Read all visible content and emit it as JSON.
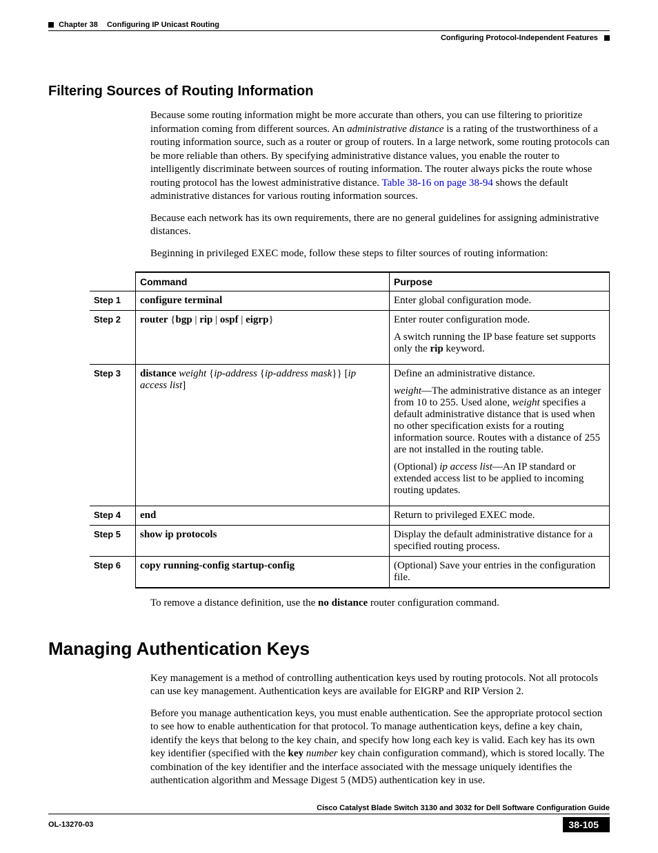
{
  "header": {
    "chapter_label": "Chapter 38",
    "chapter_title": "Configuring IP Unicast Routing",
    "section_title": "Configuring Protocol-Independent Features"
  },
  "section1": {
    "heading": "Filtering Sources of Routing Information",
    "p1_a": "Because some routing information might be more accurate than others, you can use filtering to prioritize information coming from different sources. An ",
    "p1_b_ital": "administrative distance",
    "p1_c": " is a rating of the trustworthiness of a routing information source, such as a router or group of routers. In a large network, some routing protocols can be more reliable than others. By specifying administrative distance values, you enable the router to intelligently discriminate between sources of routing information. The router always picks the route whose routing protocol has the lowest administrative distance. ",
    "p1_link": "Table 38-16 on page 38-94",
    "p1_d": " shows the default administrative distances for various routing information sources.",
    "p2": "Because each network has its own requirements, there are no general guidelines for assigning administrative distances.",
    "p3": "Beginning in privileged EXEC mode, follow these steps to filter sources of routing information:",
    "after_table_a": "To remove a distance definition, use the ",
    "after_table_b": "no distance",
    "after_table_c": " router configuration command."
  },
  "table": {
    "col_command": "Command",
    "col_purpose": "Purpose",
    "rows": [
      {
        "step": "Step 1",
        "cmd_html": "<span class='bold'>configure terminal</span>",
        "purpose_html": "Enter global configuration mode."
      },
      {
        "step": "Step 2",
        "cmd_html": "<span class='bold'>router</span> {<span class='bold'>bgp</span> | <span class='bold'>rip</span> | <span class='bold'>ospf</span> | <span class='bold'>eigrp</span>}",
        "purpose_html": "<div class='purpose-block'>Enter router configuration mode.</div><div class='purpose-block'>A switch running the IP base feature set supports only the <span class='bold'>rip</span> keyword.</div>"
      },
      {
        "step": "Step 3",
        "cmd_html": "<span class='bold'>distance</span> <span class='ital'>weight</span> {<span class='ital'>ip-address</span> {<span class='ital'>ip-address mask</span>}} [<span class='ital'>ip access list</span>]",
        "purpose_html": "<div class='purpose-block'>Define an administrative distance.</div><div class='purpose-block'><span class='ital'>weight</span>—The administrative distance as an integer from 10 to 255. Used alone, <span class='ital'>weight</span> specifies a default administrative distance that is used when no other specification exists for a routing information source. Routes with a distance of 255 are not installed in the routing table.</div><div class='purpose-block'>(Optional) <span class='ital'>ip access list</span>—An IP standard or extended access list to be applied to incoming routing updates.</div>"
      },
      {
        "step": "Step 4",
        "cmd_html": "<span class='bold'>end</span>",
        "purpose_html": "Return to privileged EXEC mode."
      },
      {
        "step": "Step 5",
        "cmd_html": "<span class='bold'>show ip protocols</span>",
        "purpose_html": "Display the default administrative distance for a specified routing process."
      },
      {
        "step": "Step 6",
        "cmd_html": "<span class='bold'>copy running-config startup-config</span>",
        "purpose_html": "(Optional) Save your entries in the configuration file."
      }
    ]
  },
  "section2": {
    "heading": "Managing Authentication Keys",
    "p1": "Key management is a method of controlling authentication keys used by routing protocols. Not all protocols can use key management. Authentication keys are available for EIGRP and RIP Version 2.",
    "p2_a": "Before you manage authentication keys, you must enable authentication. See the appropriate protocol section to see how to enable authentication for that protocol. To manage authentication keys, define a key chain, identify the keys that belong to the key chain, and specify how long each key is valid. Each key has its own key identifier (specified with the ",
    "p2_b": "key",
    "p2_c_ital": "number",
    "p2_d": " key chain configuration command), which is stored locally. The combination of the key identifier and the interface associated with the message uniquely identifies the authentication algorithm and Message Digest 5 (MD5) authentication key in use."
  },
  "footer": {
    "guide": "Cisco Catalyst Blade Switch 3130 and 3032 for Dell Software Configuration Guide",
    "ol": "OL-13270-03",
    "page": "38-105"
  }
}
